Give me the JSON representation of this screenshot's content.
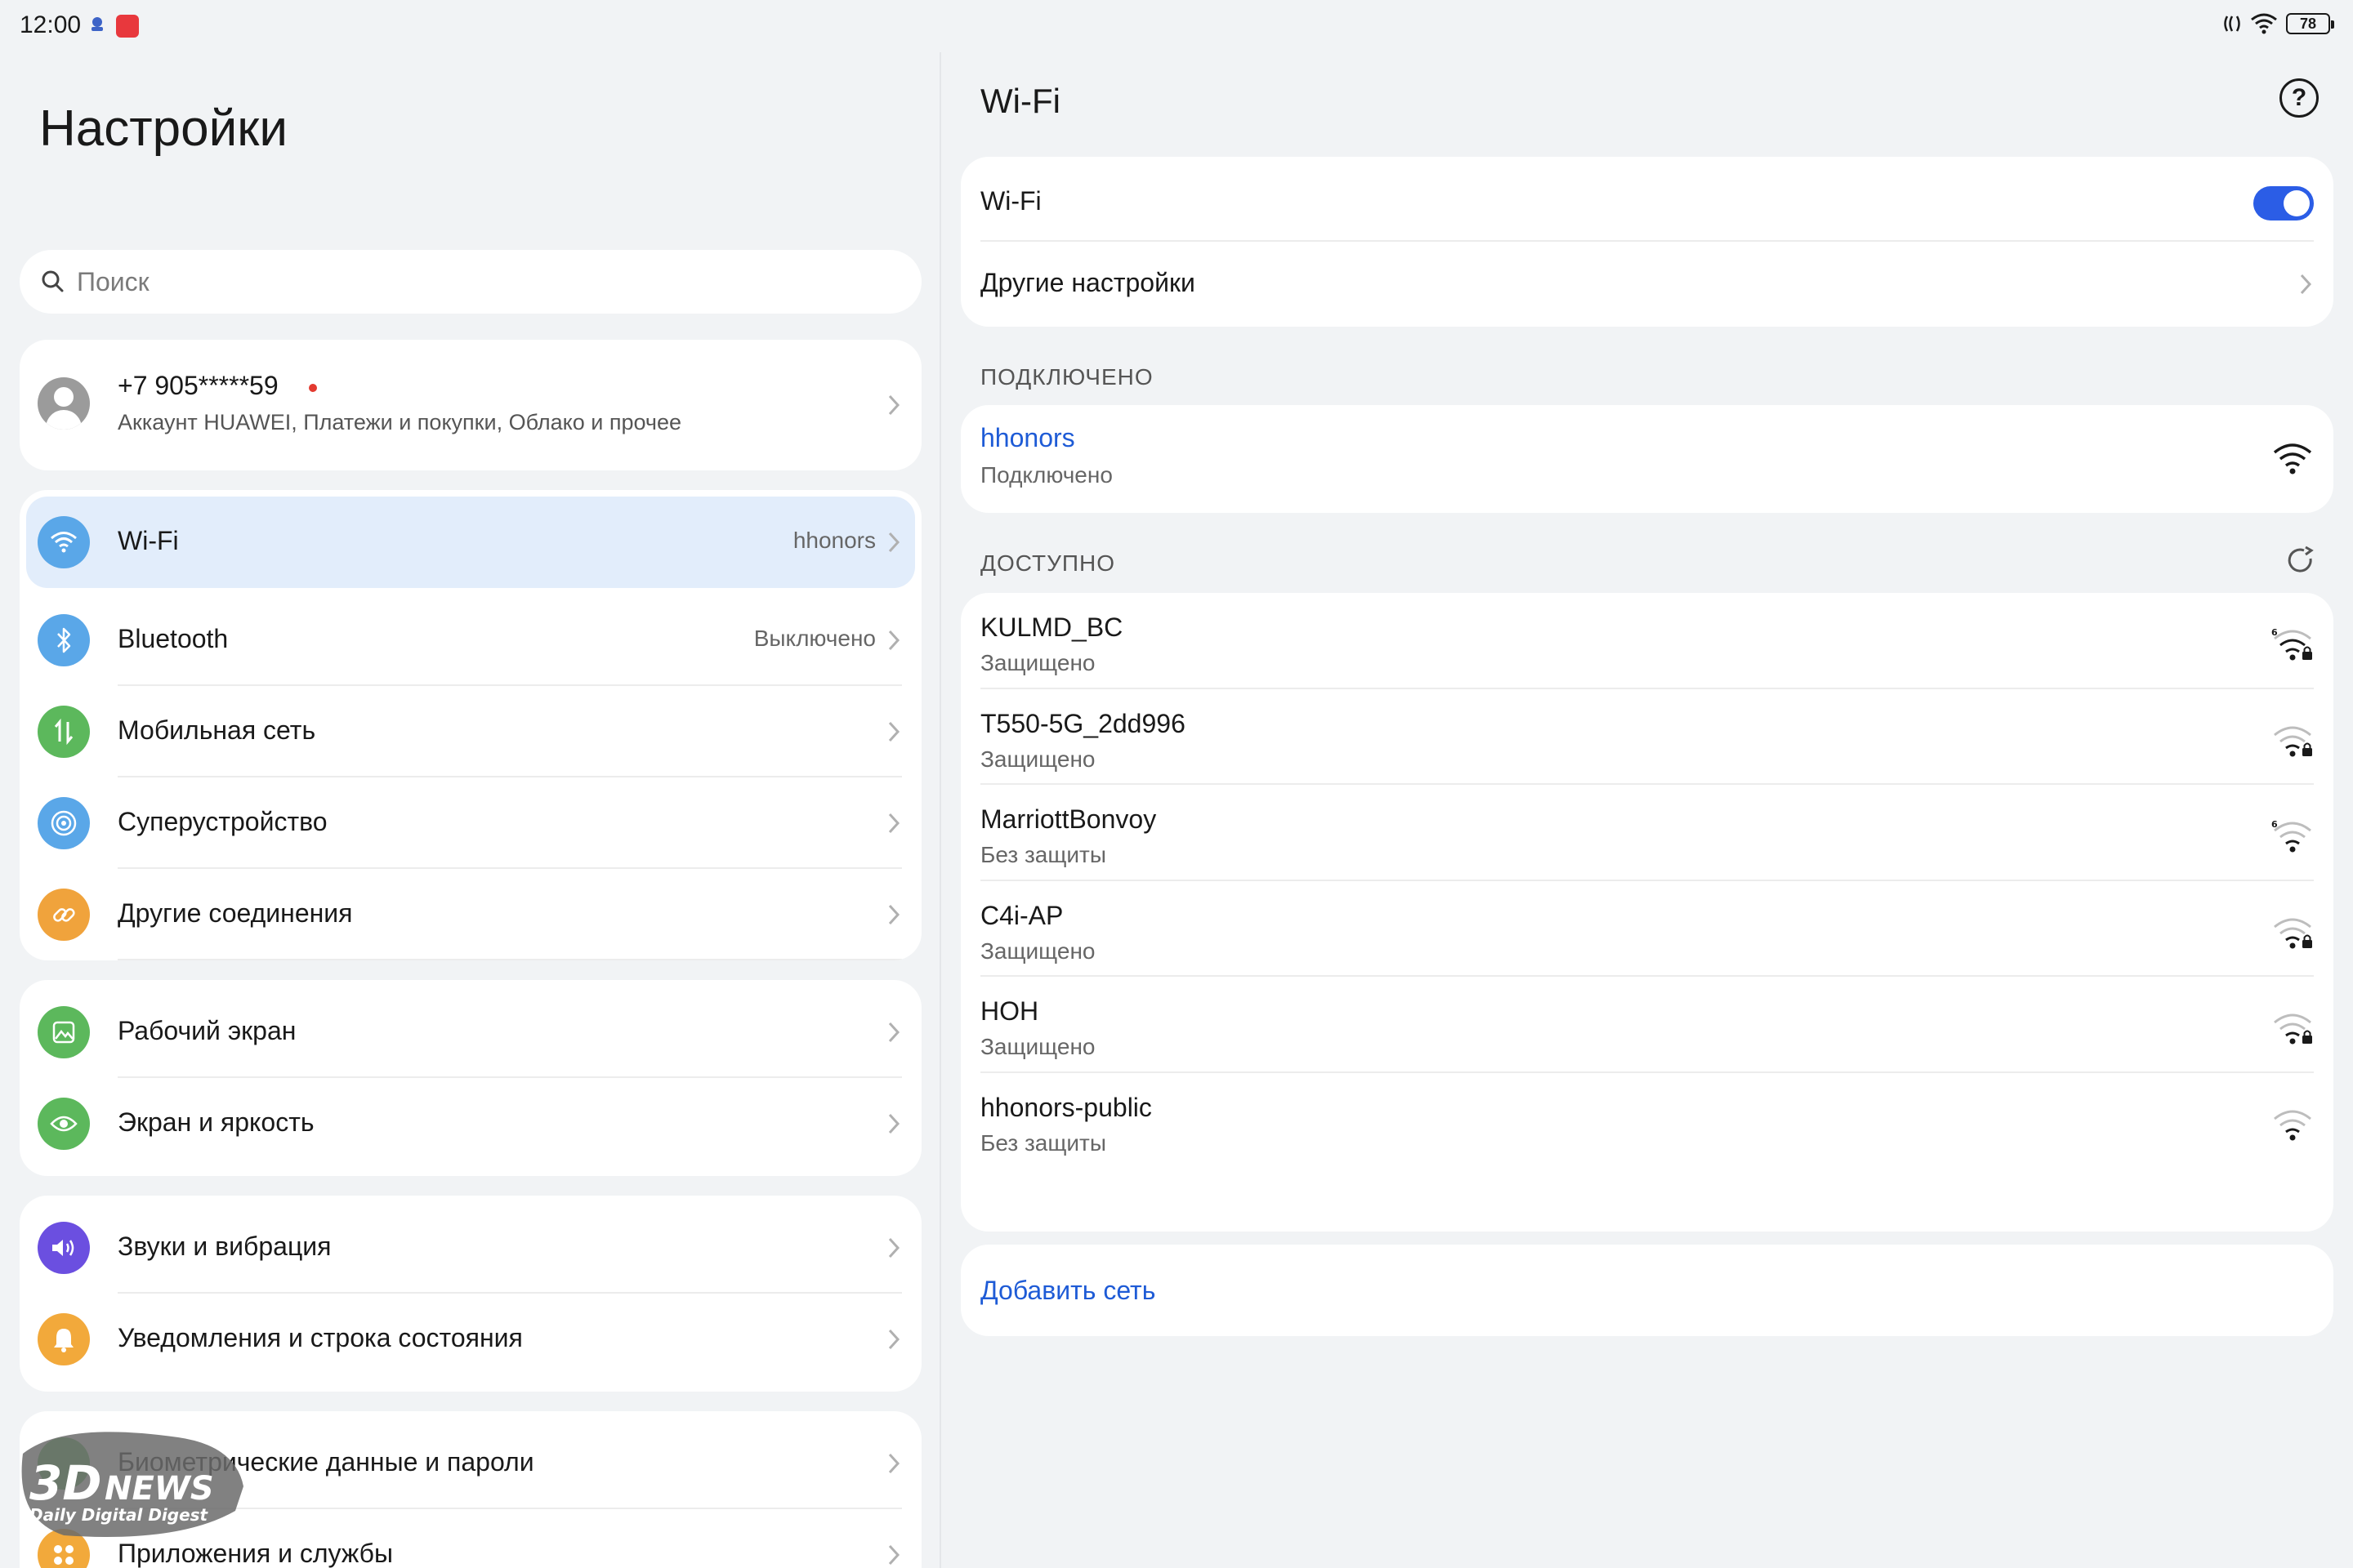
{
  "status_bar": {
    "time": "12:00",
    "battery": "78"
  },
  "left": {
    "title": "Настройки",
    "search_placeholder": "Поиск",
    "account": {
      "phone": "+7 905*****59",
      "subtitle": "Аккаунт HUAWEI, Платежи и покупки, Облако и прочее"
    },
    "groups": [
      [
        {
          "label": "Wi-Fi",
          "value": "hhonors",
          "icon": "wifi-icon",
          "color": "#5aa7e8"
        },
        {
          "label": "Bluetooth",
          "value": "Выключено",
          "icon": "bluetooth-icon",
          "color": "#5aa7e8"
        },
        {
          "label": "Мобильная сеть",
          "value": "",
          "icon": "mobile-data-icon",
          "color": "#5cb85c"
        },
        {
          "label": "Суперустройство",
          "value": "",
          "icon": "super-device-icon",
          "color": "#5aa7e8"
        },
        {
          "label": "Другие соединения",
          "value": "",
          "icon": "link-icon",
          "color": "#f0a33c"
        }
      ],
      [
        {
          "label": "Рабочий экран",
          "value": "",
          "icon": "home-screen-icon",
          "color": "#5cb85c"
        },
        {
          "label": "Экран и яркость",
          "value": "",
          "icon": "eye-icon",
          "color": "#5cb85c"
        }
      ],
      [
        {
          "label": "Звуки и вибрация",
          "value": "",
          "icon": "sound-icon",
          "color": "#6b4fe0"
        },
        {
          "label": "Уведомления и строка состояния",
          "value": "",
          "icon": "bell-icon",
          "color": "#f2a93b"
        }
      ],
      [
        {
          "label": "Биометрические данные и пароли",
          "value": "",
          "icon": "key-icon",
          "color": "#5cb85c"
        },
        {
          "label": "Приложения и службы",
          "value": "",
          "icon": "apps-icon",
          "color": "#f2a93b"
        }
      ]
    ]
  },
  "right": {
    "title": "Wi-Fi",
    "toggle_label": "Wi-Fi",
    "toggle_on": true,
    "more_settings": "Другие настройки",
    "connected_header": "ПОДКЛЮЧЕНО",
    "connected": {
      "name": "hhonors",
      "status": "Подключено"
    },
    "available_header": "ДОСТУПНО",
    "networks": [
      {
        "name": "KULMD_BC",
        "status": "Защищено",
        "secured": true,
        "wifi6": true
      },
      {
        "name": "T550-5G_2dd996",
        "status": "Защищено",
        "secured": true,
        "wifi6": false
      },
      {
        "name": "MarriottBonvoy",
        "status": "Без защиты",
        "secured": false,
        "wifi6": true
      },
      {
        "name": "C4i-AP",
        "status": "Защищено",
        "secured": true,
        "wifi6": false
      },
      {
        "name": "HOH",
        "status": "Защищено",
        "secured": true,
        "wifi6": false
      },
      {
        "name": "hhonors-public",
        "status": "Без защиты",
        "secured": false,
        "wifi6": false
      }
    ],
    "add_network": "Добавить сеть"
  },
  "watermark": {
    "brand": "3DNEWS",
    "tagline": "Daily Digital Digest"
  },
  "colors": {
    "accent": "#1e5bd6",
    "toggle": "#2b5de6",
    "selected_row": "#e2edfb"
  }
}
